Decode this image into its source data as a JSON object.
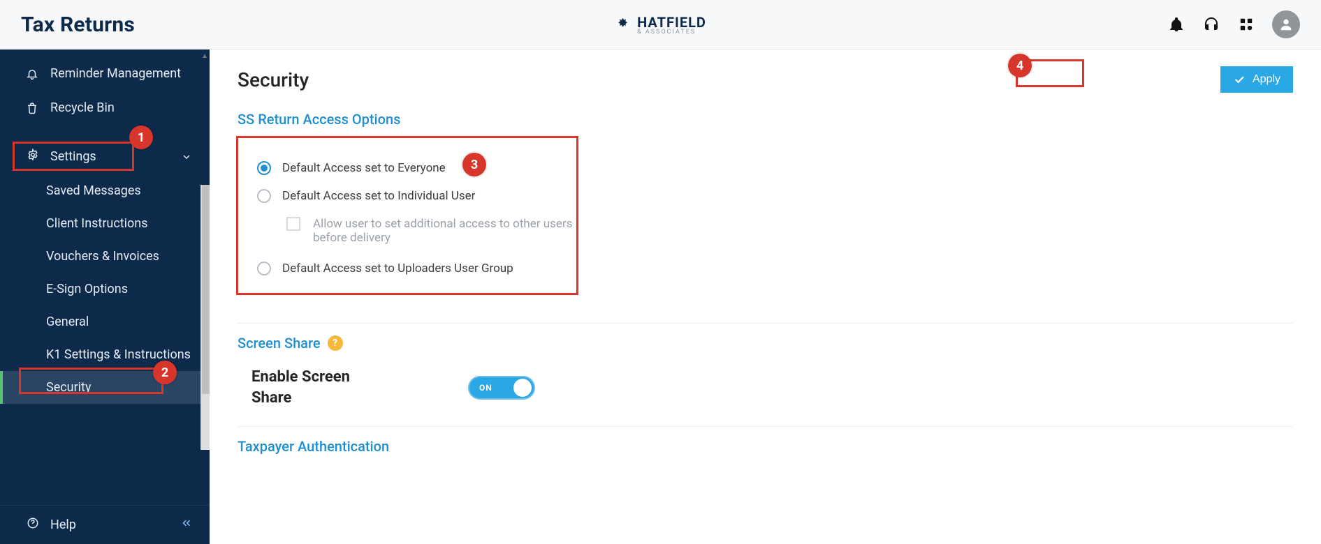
{
  "header": {
    "app_title": "Tax Returns",
    "logo_text": "HATFIELD",
    "logo_sub": "& ASSOCIATES"
  },
  "sidebar": {
    "reminder": "Reminder Management",
    "recycle": "Recycle Bin",
    "settings": "Settings",
    "subs": {
      "saved_messages": "Saved Messages",
      "client_instructions": "Client Instructions",
      "vouchers": "Vouchers & Invoices",
      "esign": "E-Sign Options",
      "general": "General",
      "k1": "K1 Settings & Instructions",
      "security": "Security"
    },
    "help": "Help"
  },
  "page": {
    "title": "Security",
    "apply": "Apply"
  },
  "access": {
    "section_title": "SS Return Access Options",
    "opt_everyone": "Default Access set to Everyone",
    "opt_individual": "Default Access set to Individual User",
    "allow_additional": "Allow user to set additional access to other users before delivery",
    "opt_uploaders": "Default Access set to Uploaders User Group"
  },
  "screenshare": {
    "section_title": "Screen Share",
    "enable_label": "Enable Screen Share",
    "state": "ON"
  },
  "auth": {
    "section_title": "Taxpayer Authentication"
  },
  "callouts": {
    "c1": "1",
    "c2": "2",
    "c3": "3",
    "c4": "4"
  }
}
